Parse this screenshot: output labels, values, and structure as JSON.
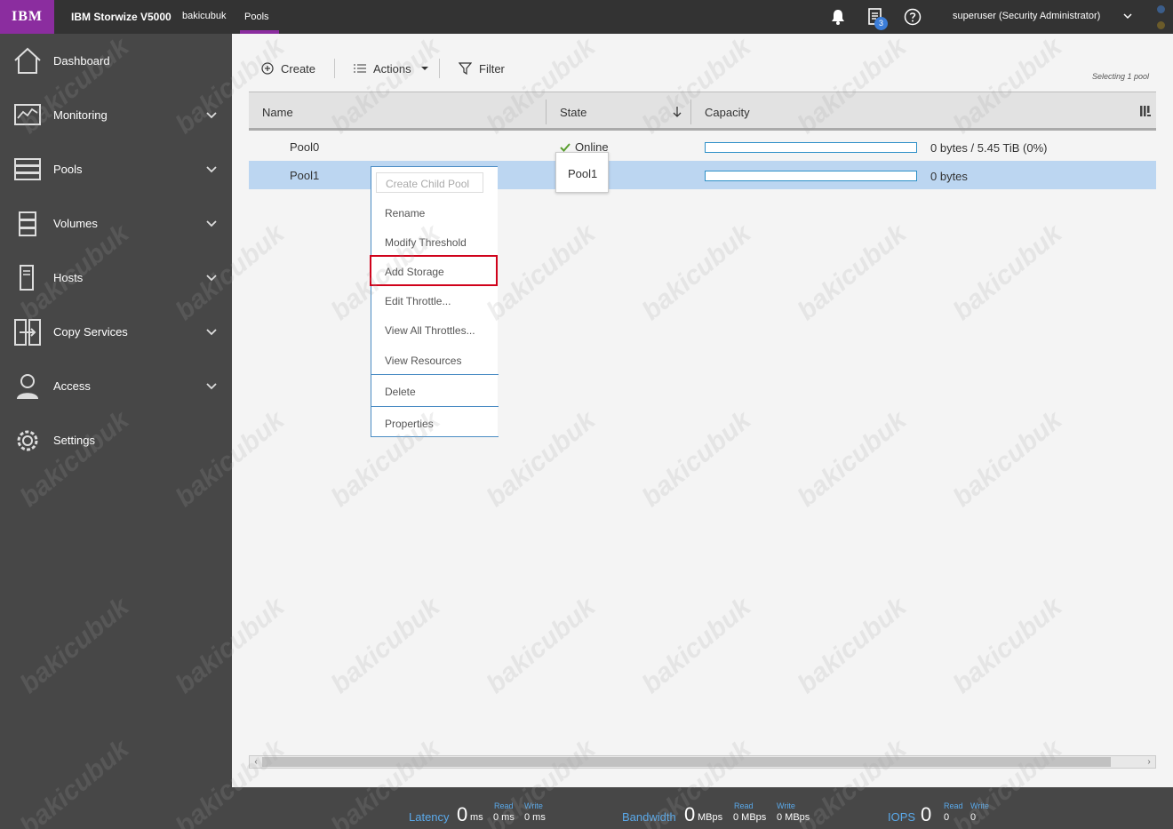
{
  "topbar": {
    "logo": "IBM",
    "product": "IBM Storwize V5000",
    "system_name": "bakicubuk",
    "current_page": "Pools",
    "task_count": "3",
    "user": "superuser (Security Administrator)"
  },
  "sidebar": {
    "items": [
      {
        "label": "Dashboard",
        "icon": "home-icon"
      },
      {
        "label": "Monitoring",
        "icon": "monitoring-icon"
      },
      {
        "label": "Pools",
        "icon": "pools-icon"
      },
      {
        "label": "Volumes",
        "icon": "volumes-icon"
      },
      {
        "label": "Hosts",
        "icon": "hosts-icon"
      },
      {
        "label": "Copy Services",
        "icon": "copy-services-icon"
      },
      {
        "label": "Access",
        "icon": "access-icon"
      },
      {
        "label": "Settings",
        "icon": "settings-icon"
      }
    ]
  },
  "toolbar": {
    "create_label": "Create",
    "actions_label": "Actions",
    "filter_label": "Filter",
    "selection_status": "Selecting 1 pool"
  },
  "table": {
    "columns": [
      "Name",
      "State",
      "Capacity"
    ],
    "rows": [
      {
        "name": "Pool0",
        "state": "Online",
        "capacity": "0 bytes / 5.45 TiB (0%)",
        "used_fraction": 0
      },
      {
        "name": "Pool1",
        "state": "",
        "capacity": "0 bytes",
        "used_fraction": 0
      }
    ]
  },
  "tooltip": {
    "text": "Pool1"
  },
  "context_menu": {
    "items": [
      "Create Child Pool",
      "Rename",
      "Modify Threshold",
      "Add Storage",
      "Edit Throttle...",
      "View All Throttles...",
      "View Resources",
      "Delete",
      "Properties"
    ]
  },
  "statusbar": {
    "latency": {
      "label": "Latency",
      "value": "0",
      "unit": "ms",
      "read_label": "Read",
      "read_value": "0 ms",
      "write_label": "Write",
      "write_value": "0 ms"
    },
    "bandwidth": {
      "label": "Bandwidth",
      "value": "0",
      "unit": "MBps",
      "read_label": "Read",
      "read_value": "0 MBps",
      "write_label": "Write",
      "write_value": "0 MBps"
    },
    "iops": {
      "label": "IOPS",
      "value": "0",
      "read_label": "Read",
      "read_value": "0",
      "write_label": "Write",
      "write_value": "0"
    }
  },
  "watermark": "bakicubuk",
  "colors": {
    "brand": "#8b2d9f",
    "topbar": "#333333",
    "sidebar": "#474747",
    "selection": "#bcd6f1",
    "capacity_bar": "#2c8fc7",
    "highlight": "#d0021b",
    "online": "#5a9e2f"
  }
}
